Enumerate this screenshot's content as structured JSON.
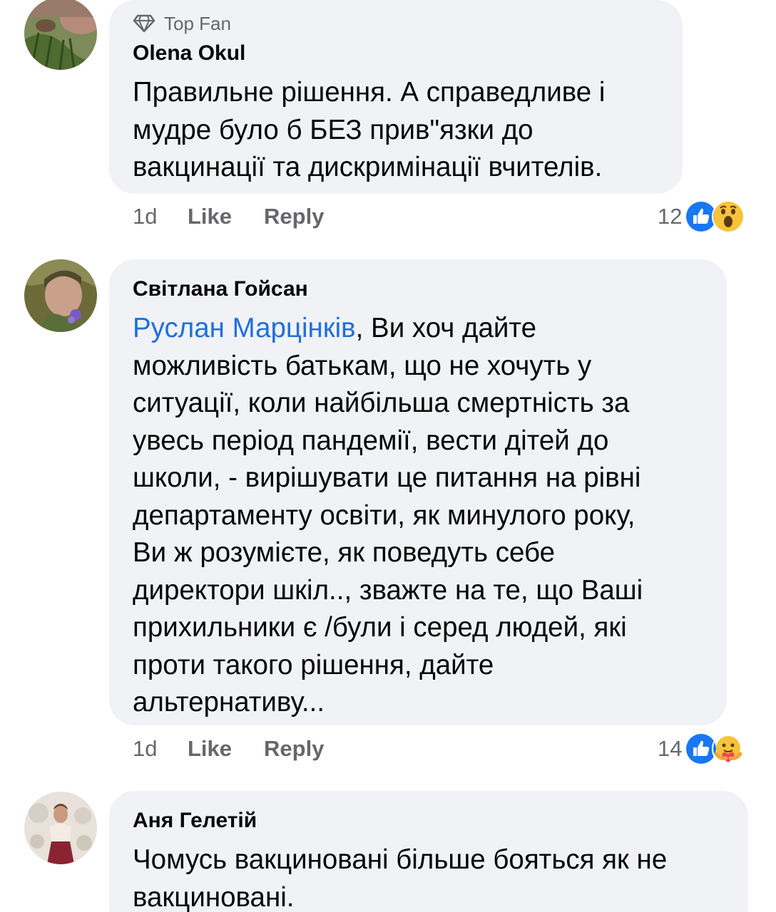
{
  "colors": {
    "bubble_bg": "#f0f2f5",
    "mention": "#216fdb",
    "meta_text": "#65676b",
    "like_blue": "#1877f2"
  },
  "comments": [
    {
      "badge_icon": "diamond-icon",
      "badge": "Top Fan",
      "author": "Olena  Okul",
      "text": "Правильне рішення. А справедливе і\nмудре було б БЕЗ прив\"язки до\nвакцинації та дискримінації вчителів.",
      "time": "1d",
      "like_label": "Like",
      "reply_label": "Reply",
      "reaction_count": "12",
      "reactions": [
        "like-icon",
        "wow-icon"
      ]
    },
    {
      "author": "Світлана Гойсан",
      "mention": "Руслан Марцінків",
      "text": ", Ви хоч дайте\nможливість батькам, що не хочуть у\nситуації, коли найбільша смертність за\nувесь період пандемії, вести дітей до\nшколи, - вирішувати це питання на рівні\nдепартаменту освіти, як минулого року,\nВи ж розумієте, як поведуть себе\nдиректори шкіл.., зважте на те, що Ваші\nприхильники є /були і серед людей, які\nпроти такого рішення, дайте\nальтернативу...",
      "time": "1d",
      "like_label": "Like",
      "reply_label": "Reply",
      "reaction_count": "14",
      "reactions": [
        "like-icon",
        "care-icon"
      ]
    },
    {
      "author": "Аня Гелетій",
      "text": "Чомусь вакциновані більше бояться як не\nвакциновані."
    }
  ]
}
